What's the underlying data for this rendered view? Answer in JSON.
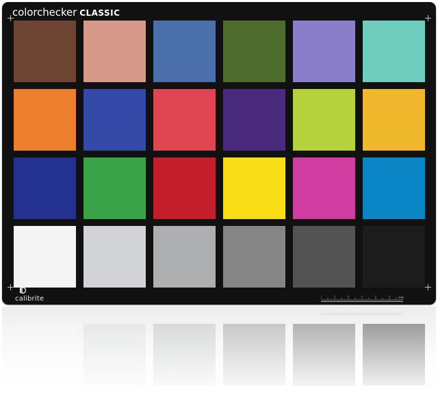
{
  "brand": {
    "word1": "color",
    "word2": "checker",
    "word3": "CLASSIC"
  },
  "logo": {
    "text": "calibrite",
    "icon": "calibrite-logo-icon"
  },
  "ruler": {
    "unit": "mm"
  },
  "colors": {
    "card": "#111111",
    "crosshair": "#bdbdbd",
    "text": "#ffffff"
  },
  "patches": [
    {
      "name": "dark-skin",
      "color": "#6e4533"
    },
    {
      "name": "light-skin",
      "color": "#d6998a"
    },
    {
      "name": "blue-sky",
      "color": "#4a6fab"
    },
    {
      "name": "foliage",
      "color": "#4d6c2e"
    },
    {
      "name": "blue-flower",
      "color": "#8a7dc9"
    },
    {
      "name": "bluish-green",
      "color": "#6fcdbd"
    },
    {
      "name": "orange",
      "color": "#ec7f2d"
    },
    {
      "name": "purplish-blue",
      "color": "#3449a8"
    },
    {
      "name": "moderate-red",
      "color": "#df4652"
    },
    {
      "name": "purple",
      "color": "#4a2a7b"
    },
    {
      "name": "yellow-green",
      "color": "#b5d13c"
    },
    {
      "name": "orange-yellow",
      "color": "#f0b82c"
    },
    {
      "name": "blue",
      "color": "#23328f"
    },
    {
      "name": "green",
      "color": "#3aa347"
    },
    {
      "name": "red",
      "color": "#c41e2c"
    },
    {
      "name": "yellow",
      "color": "#f8dd17"
    },
    {
      "name": "magenta",
      "color": "#cf3da0"
    },
    {
      "name": "cyan",
      "color": "#0a86c6"
    },
    {
      "name": "white",
      "color": "#f4f4f4"
    },
    {
      "name": "neutral-8",
      "color": "#d2d3d6"
    },
    {
      "name": "neutral-6-5",
      "color": "#aeafb1"
    },
    {
      "name": "neutral-5",
      "color": "#858585"
    },
    {
      "name": "neutral-3-5",
      "color": "#535353"
    },
    {
      "name": "black",
      "color": "#1c1c1c"
    }
  ]
}
